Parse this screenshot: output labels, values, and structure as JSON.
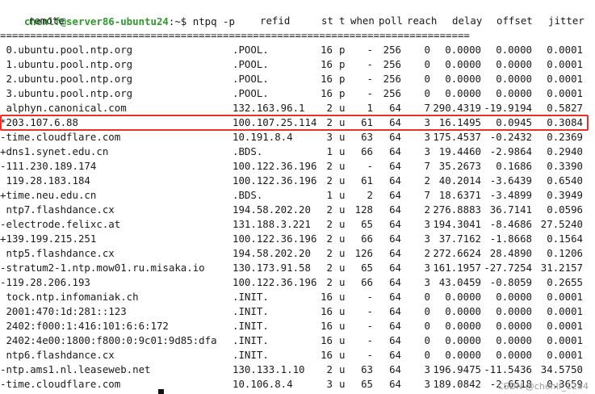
{
  "prompt": {
    "user_host": "chenlf@server86-ubuntu24",
    "rest": ":~$ ntpq -p"
  },
  "header": {
    "remote": "remote",
    "refid": "refid",
    "st": "st",
    "t": "t",
    "when": "when",
    "poll": "poll",
    "reach": "reach",
    "delay": "delay",
    "offset": "offset",
    "jitter": "jitter"
  },
  "separator": "==============================================================================",
  "rows": [
    {
      "remote": " 0.ubuntu.pool.ntp.org",
      "refid": ".POOL.",
      "st": "16",
      "t": "p",
      "when": "-",
      "poll": "256",
      "reach": "0",
      "delay": "0.0000",
      "offset": "0.0000",
      "jitter": "0.0001"
    },
    {
      "remote": " 1.ubuntu.pool.ntp.org",
      "refid": ".POOL.",
      "st": "16",
      "t": "p",
      "when": "-",
      "poll": "256",
      "reach": "0",
      "delay": "0.0000",
      "offset": "0.0000",
      "jitter": "0.0001"
    },
    {
      "remote": " 2.ubuntu.pool.ntp.org",
      "refid": ".POOL.",
      "st": "16",
      "t": "p",
      "when": "-",
      "poll": "256",
      "reach": "0",
      "delay": "0.0000",
      "offset": "0.0000",
      "jitter": "0.0001"
    },
    {
      "remote": " 3.ubuntu.pool.ntp.org",
      "refid": ".POOL.",
      "st": "16",
      "t": "p",
      "when": "-",
      "poll": "256",
      "reach": "0",
      "delay": "0.0000",
      "offset": "0.0000",
      "jitter": "0.0001"
    },
    {
      "remote": " alphyn.canonical.com",
      "refid": "132.163.96.1",
      "st": "2",
      "t": "u",
      "when": "1",
      "poll": "64",
      "reach": "7",
      "delay": "290.4319",
      "offset": "-19.9194",
      "jitter": "0.5827"
    },
    {
      "remote": "*203.107.6.88",
      "refid": "100.107.25.114",
      "st": "2",
      "t": "u",
      "when": "61",
      "poll": "64",
      "reach": "3",
      "delay": "16.1495",
      "offset": "0.0945",
      "jitter": "0.3084"
    },
    {
      "remote": "-time.cloudflare.com",
      "refid": "10.191.8.4",
      "st": "3",
      "t": "u",
      "when": "63",
      "poll": "64",
      "reach": "3",
      "delay": "175.4537",
      "offset": "-0.2432",
      "jitter": "0.2369"
    },
    {
      "remote": "+dns1.synet.edu.cn",
      "refid": ".BDS.",
      "st": "1",
      "t": "u",
      "when": "66",
      "poll": "64",
      "reach": "3",
      "delay": "19.4460",
      "offset": "-2.9864",
      "jitter": "0.2940"
    },
    {
      "remote": "-111.230.189.174",
      "refid": "100.122.36.196",
      "st": "2",
      "t": "u",
      "when": "-",
      "poll": "64",
      "reach": "7",
      "delay": "35.2673",
      "offset": "0.1686",
      "jitter": "0.3390"
    },
    {
      "remote": " 119.28.183.184",
      "refid": "100.122.36.196",
      "st": "2",
      "t": "u",
      "when": "61",
      "poll": "64",
      "reach": "2",
      "delay": "40.2014",
      "offset": "-3.6439",
      "jitter": "0.6540"
    },
    {
      "remote": "+time.neu.edu.cn",
      "refid": ".BDS.",
      "st": "1",
      "t": "u",
      "when": "2",
      "poll": "64",
      "reach": "7",
      "delay": "18.6371",
      "offset": "-3.4899",
      "jitter": "0.3949"
    },
    {
      "remote": " ntp7.flashdance.cx",
      "refid": "194.58.202.20",
      "st": "2",
      "t": "u",
      "when": "128",
      "poll": "64",
      "reach": "2",
      "delay": "276.8883",
      "offset": "36.7141",
      "jitter": "0.0596"
    },
    {
      "remote": "-electrode.felixc.at",
      "refid": "131.188.3.221",
      "st": "2",
      "t": "u",
      "when": "65",
      "poll": "64",
      "reach": "3",
      "delay": "194.3041",
      "offset": "-8.4686",
      "jitter": "27.5240"
    },
    {
      "remote": "+139.199.215.251",
      "refid": "100.122.36.196",
      "st": "2",
      "t": "u",
      "when": "66",
      "poll": "64",
      "reach": "3",
      "delay": "37.7162",
      "offset": "-1.8668",
      "jitter": "0.1564"
    },
    {
      "remote": " ntp5.flashdance.cx",
      "refid": "194.58.202.20",
      "st": "2",
      "t": "u",
      "when": "126",
      "poll": "64",
      "reach": "2",
      "delay": "272.6624",
      "offset": "28.4890",
      "jitter": "0.1206"
    },
    {
      "remote": "-stratum2-1.ntp.mow01.ru.misaka.io",
      "refid": "130.173.91.58",
      "st": "2",
      "t": "u",
      "when": "65",
      "poll": "64",
      "reach": "3",
      "delay": "161.1957",
      "offset": "-27.7254",
      "jitter": "31.2157"
    },
    {
      "remote": "-119.28.206.193",
      "refid": "100.122.36.196",
      "st": "2",
      "t": "u",
      "when": "66",
      "poll": "64",
      "reach": "3",
      "delay": "43.0459",
      "offset": "-0.8059",
      "jitter": "0.2655"
    },
    {
      "remote": " tock.ntp.infomaniak.ch",
      "refid": ".INIT.",
      "st": "16",
      "t": "u",
      "when": "-",
      "poll": "64",
      "reach": "0",
      "delay": "0.0000",
      "offset": "0.0000",
      "jitter": "0.0001"
    },
    {
      "remote": " 2001:470:1d:281::123",
      "refid": ".INIT.",
      "st": "16",
      "t": "u",
      "when": "-",
      "poll": "64",
      "reach": "0",
      "delay": "0.0000",
      "offset": "0.0000",
      "jitter": "0.0001"
    },
    {
      "remote": " 2402:f000:1:416:101:6:6:172",
      "refid": ".INIT.",
      "st": "16",
      "t": "u",
      "when": "-",
      "poll": "64",
      "reach": "0",
      "delay": "0.0000",
      "offset": "0.0000",
      "jitter": "0.0001"
    },
    {
      "remote": " 2402:4e00:1800:f800:0:9c01:9d85:dfa",
      "refid": ".INIT.",
      "st": "16",
      "t": "u",
      "when": "-",
      "poll": "64",
      "reach": "0",
      "delay": "0.0000",
      "offset": "0.0000",
      "jitter": "0.0001"
    },
    {
      "remote": " ntp6.flashdance.cx",
      "refid": ".INIT.",
      "st": "16",
      "t": "u",
      "when": "-",
      "poll": "64",
      "reach": "0",
      "delay": "0.0000",
      "offset": "0.0000",
      "jitter": "0.0001"
    },
    {
      "remote": "-ntp.ams1.nl.leaseweb.net",
      "refid": "130.133.1.10",
      "st": "2",
      "t": "u",
      "when": "63",
      "poll": "64",
      "reach": "3",
      "delay": "196.9475",
      "offset": "-11.5436",
      "jitter": "34.5750"
    },
    {
      "remote": "-time.cloudflare.com",
      "refid": "10.106.8.4",
      "st": "3",
      "t": "u",
      "when": "65",
      "poll": "64",
      "reach": "3",
      "delay": "189.0842",
      "offset": "-2.6518",
      "jitter": "0.3659"
    }
  ],
  "highlight_remote": "*203.107.6.88",
  "highlight_color": "#e8312b",
  "prompt_color": "#2e9a2e",
  "watermark": "CSDN @chenlf_1234"
}
